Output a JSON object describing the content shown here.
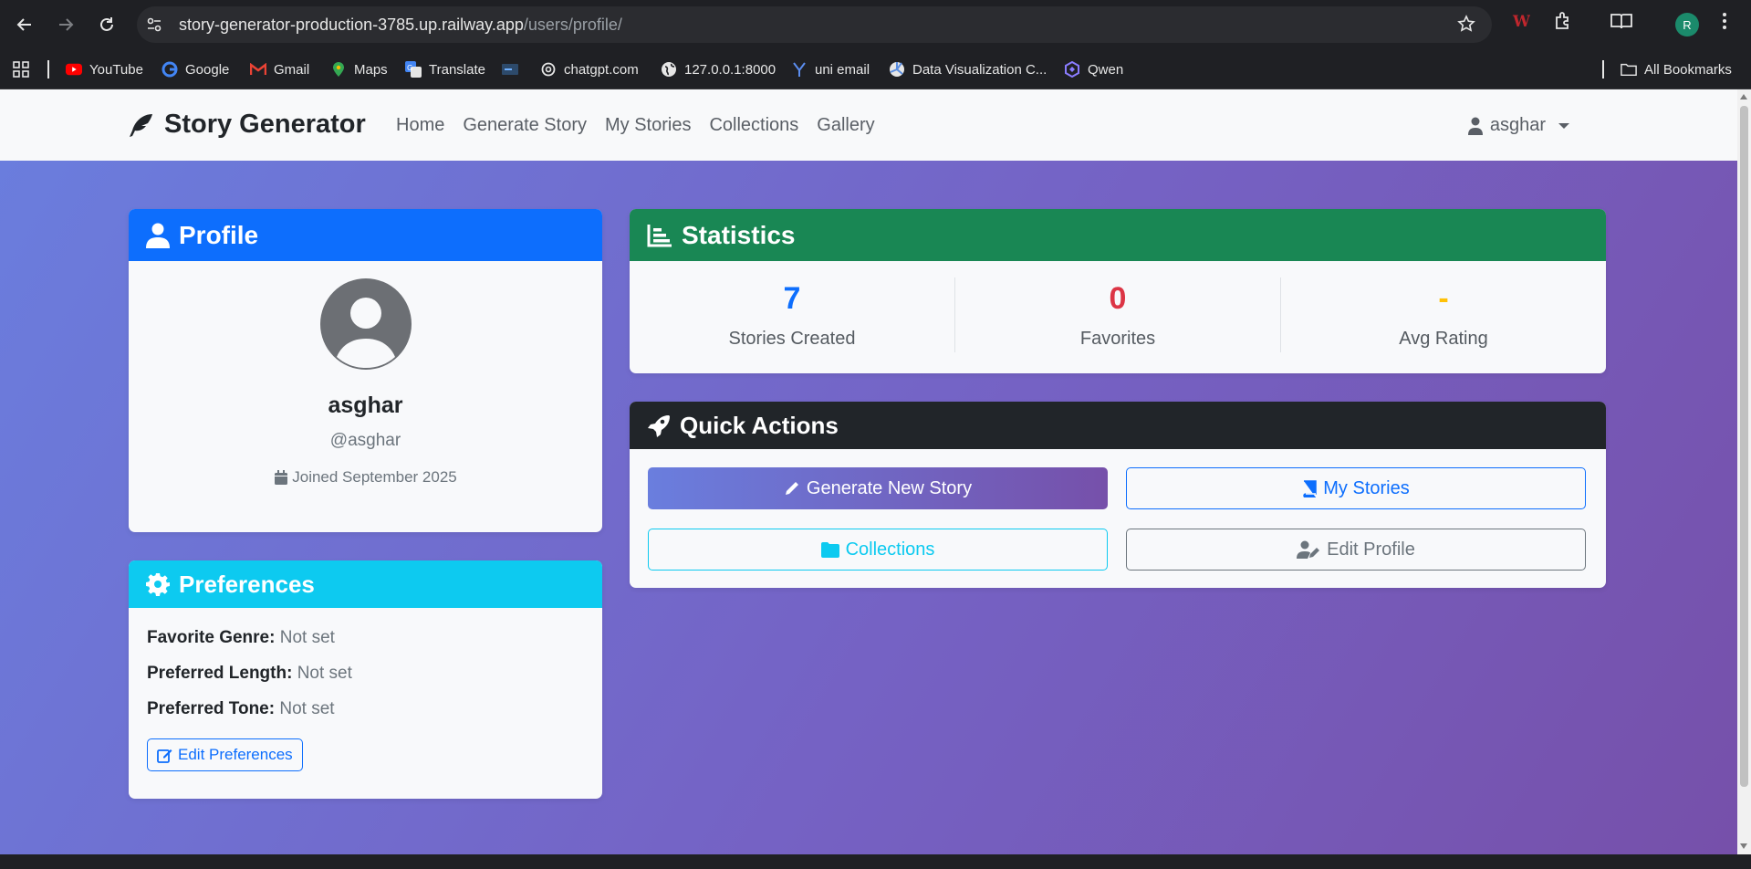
{
  "browser": {
    "url_host": "story-generator-production-3785.up.railway.app",
    "url_path": "/users/profile/",
    "profile_initial": "R",
    "bookmarks": [
      "YouTube",
      "Google",
      "Gmail",
      "Maps",
      "Translate",
      "chatgpt.com",
      "127.0.0.1:8000",
      "uni email",
      "Data Visualization C...",
      "Qwen"
    ],
    "all_bookmarks": "All Bookmarks"
  },
  "navbar": {
    "brand": "Story Generator",
    "links": [
      "Home",
      "Generate Story",
      "My Stories",
      "Collections",
      "Gallery"
    ],
    "user": "asghar"
  },
  "profile": {
    "title": "Profile",
    "name": "asghar",
    "handle": "@asghar",
    "joined": "Joined September 2025",
    "header_color": "#0d6efd"
  },
  "preferences": {
    "title": "Preferences",
    "header_color": "#0dcaf0",
    "rows": [
      {
        "label": "Favorite Genre:",
        "value": "Not set"
      },
      {
        "label": "Preferred Length:",
        "value": "Not set"
      },
      {
        "label": "Preferred Tone:",
        "value": "Not set"
      }
    ],
    "edit_label": "Edit Preferences"
  },
  "statistics": {
    "title": "Statistics",
    "header_color": "#198754",
    "items": [
      {
        "value": "7",
        "label": "Stories Created",
        "color": "#0d6efd"
      },
      {
        "value": "0",
        "label": "Favorites",
        "color": "#dc3545"
      },
      {
        "value": "-",
        "label": "Avg Rating",
        "color": "#ffc107"
      }
    ]
  },
  "quick_actions": {
    "title": "Quick Actions",
    "header_color": "#212529",
    "generate": "Generate New Story",
    "my_stories": "My Stories",
    "collections": "Collections",
    "edit_profile": "Edit Profile"
  }
}
